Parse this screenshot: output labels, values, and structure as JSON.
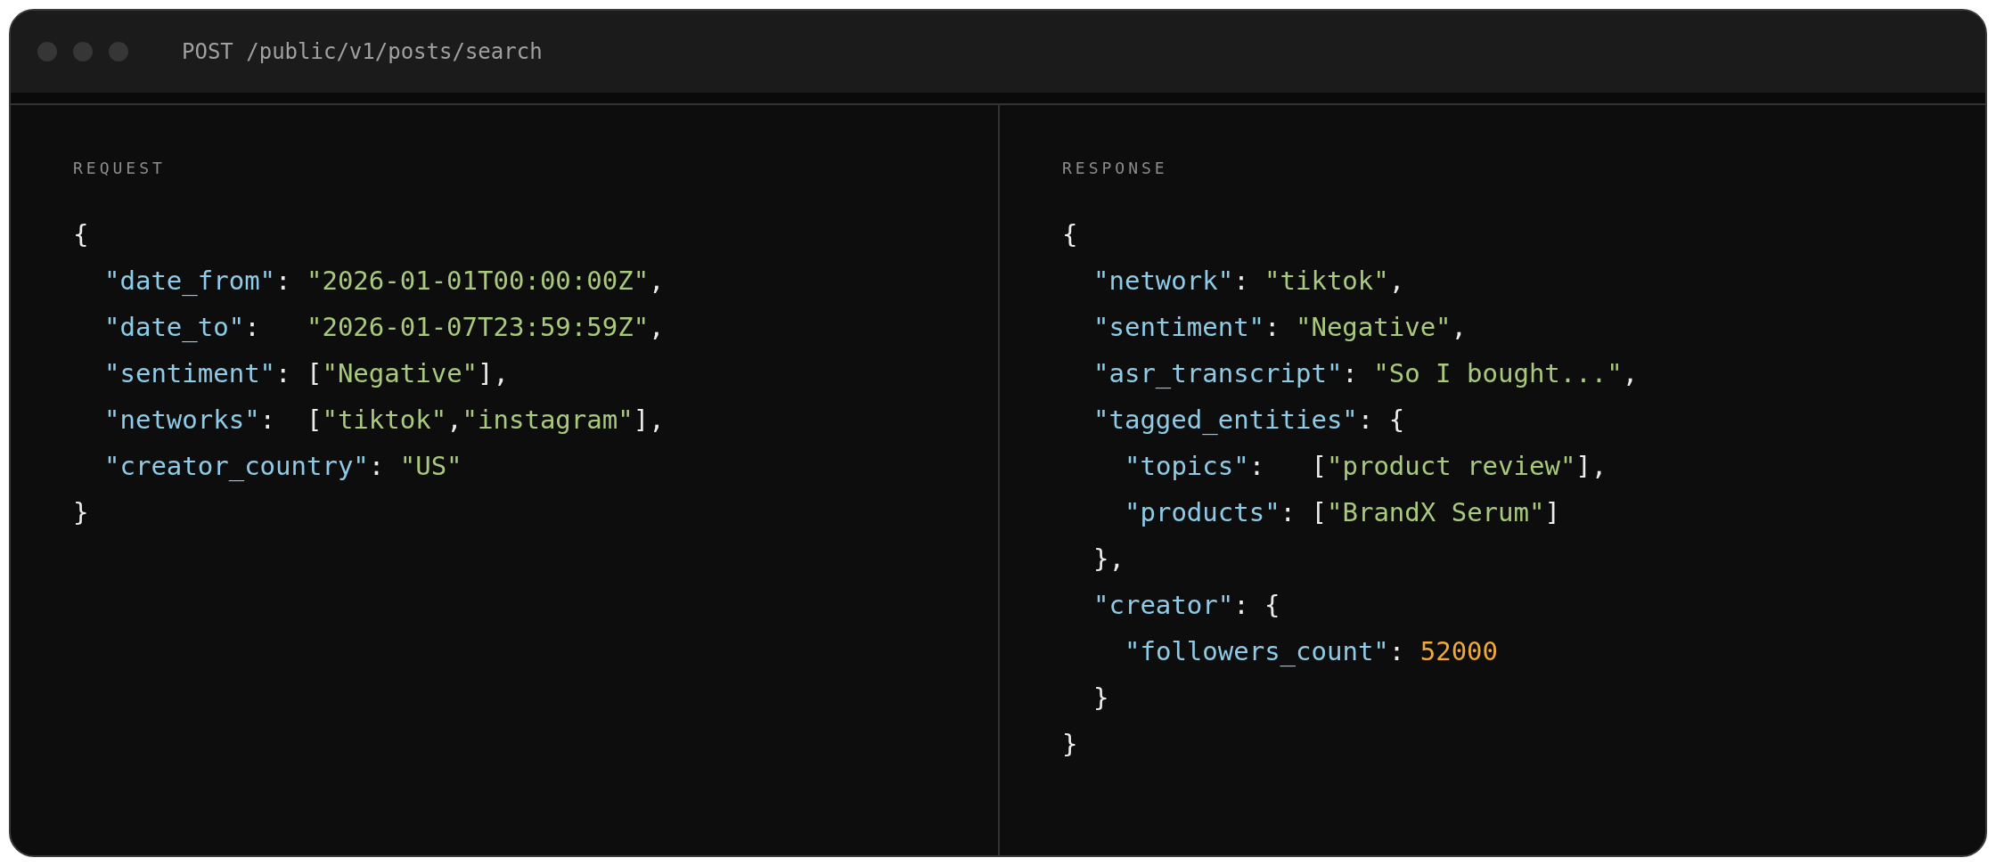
{
  "window": {
    "title": "POST /public/v1/posts/search"
  },
  "panels": [
    {
      "label": "REQUEST",
      "lines": [
        {
          "tokens": [
            {
              "kind": "punct",
              "text": "{"
            }
          ],
          "children": [
            {
              "tokens": [
                {
                  "kind": "key",
                  "text": "\"date_from\""
                },
                {
                  "kind": "punct",
                  "text": ": "
                },
                {
                  "kind": "string",
                  "text": "\"2026-01-01T00:00:00Z\""
                },
                {
                  "kind": "punct",
                  "text": ","
                }
              ]
            },
            {
              "tokens": [
                {
                  "kind": "key",
                  "text": "\"date_to\""
                },
                {
                  "kind": "punct",
                  "text": ":   "
                },
                {
                  "kind": "string",
                  "text": "\"2026-01-07T23:59:59Z\""
                },
                {
                  "kind": "punct",
                  "text": ","
                }
              ]
            },
            {
              "tokens": [
                {
                  "kind": "key",
                  "text": "\"sentiment\""
                },
                {
                  "kind": "punct",
                  "text": ": ["
                },
                {
                  "kind": "string",
                  "text": "\"Negative\""
                },
                {
                  "kind": "punct",
                  "text": "],"
                }
              ]
            },
            {
              "tokens": [
                {
                  "kind": "key",
                  "text": "\"networks\""
                },
                {
                  "kind": "punct",
                  "text": ":  ["
                },
                {
                  "kind": "string",
                  "text": "\"tiktok\""
                },
                {
                  "kind": "punct",
                  "text": ","
                },
                {
                  "kind": "string",
                  "text": "\"instagram\""
                },
                {
                  "kind": "punct",
                  "text": "],"
                }
              ]
            },
            {
              "tokens": [
                {
                  "kind": "key",
                  "text": "\"creator_country\""
                },
                {
                  "kind": "punct",
                  "text": ": "
                },
                {
                  "kind": "string",
                  "text": "\"US\""
                }
              ]
            }
          ]
        },
        {
          "tokens": [
            {
              "kind": "punct",
              "text": "}"
            }
          ]
        }
      ]
    },
    {
      "label": "RESPONSE",
      "lines": [
        {
          "tokens": [
            {
              "kind": "punct",
              "text": "{"
            }
          ],
          "children": [
            {
              "tokens": [
                {
                  "kind": "key",
                  "text": "\"network\""
                },
                {
                  "kind": "punct",
                  "text": ": "
                },
                {
                  "kind": "string",
                  "text": "\"tiktok\""
                },
                {
                  "kind": "punct",
                  "text": ","
                }
              ]
            },
            {
              "tokens": [
                {
                  "kind": "key",
                  "text": "\"sentiment\""
                },
                {
                  "kind": "punct",
                  "text": ": "
                },
                {
                  "kind": "string",
                  "text": "\"Negative\""
                },
                {
                  "kind": "punct",
                  "text": ","
                }
              ]
            },
            {
              "tokens": [
                {
                  "kind": "key",
                  "text": "\"asr_transcript\""
                },
                {
                  "kind": "punct",
                  "text": ": "
                },
                {
                  "kind": "string",
                  "text": "\"So I bought...\""
                },
                {
                  "kind": "punct",
                  "text": ","
                }
              ]
            },
            {
              "tokens": [
                {
                  "kind": "key",
                  "text": "\"tagged_entities\""
                },
                {
                  "kind": "punct",
                  "text": ": {"
                }
              ],
              "children": [
                {
                  "tokens": [
                    {
                      "kind": "key",
                      "text": "\"topics\""
                    },
                    {
                      "kind": "punct",
                      "text": ":   ["
                    },
                    {
                      "kind": "string",
                      "text": "\"product review\""
                    },
                    {
                      "kind": "punct",
                      "text": "],"
                    }
                  ]
                },
                {
                  "tokens": [
                    {
                      "kind": "key",
                      "text": "\"products\""
                    },
                    {
                      "kind": "punct",
                      "text": ": ["
                    },
                    {
                      "kind": "string",
                      "text": "\"BrandX Serum\""
                    },
                    {
                      "kind": "punct",
                      "text": "]"
                    }
                  ]
                }
              ]
            },
            {
              "tokens": [
                {
                  "kind": "punct",
                  "text": "},"
                }
              ]
            },
            {
              "tokens": [
                {
                  "kind": "key",
                  "text": "\"creator\""
                },
                {
                  "kind": "punct",
                  "text": ": {"
                }
              ],
              "children": [
                {
                  "tokens": [
                    {
                      "kind": "key",
                      "text": "\"followers_count\""
                    },
                    {
                      "kind": "punct",
                      "text": ": "
                    },
                    {
                      "kind": "number",
                      "text": "52000"
                    }
                  ]
                }
              ]
            },
            {
              "tokens": [
                {
                  "kind": "punct",
                  "text": "}"
                }
              ]
            }
          ]
        },
        {
          "tokens": [
            {
              "kind": "punct",
              "text": "}"
            }
          ]
        }
      ]
    }
  ]
}
